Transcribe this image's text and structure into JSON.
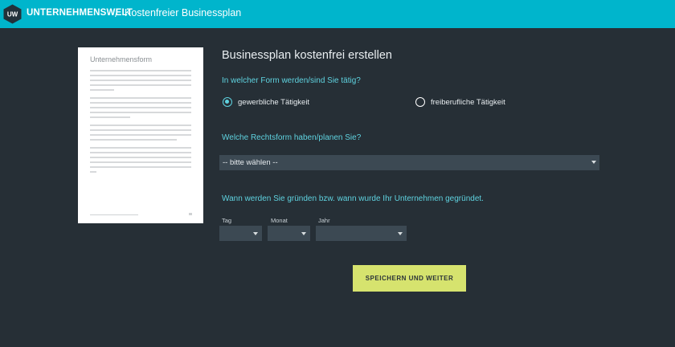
{
  "header": {
    "logo_text": "UW",
    "brand": "UNTERNEHMENSWELT",
    "separator": "/",
    "breadcrumb": "Kostenfreier Businessplan",
    "bg_color": "#00b5cc"
  },
  "preview": {
    "title": "Unternehmensform"
  },
  "form": {
    "title": "Businessplan kostenfrei erstellen",
    "question_form": "In welcher Form werden/sind Sie tätig?",
    "options": [
      {
        "label": "gewerbliche Tätigkeit",
        "selected": true
      },
      {
        "label": "freiberufliche Tätigkeit",
        "selected": false
      }
    ],
    "question_rechtsform": "Welche Rechtsform haben/planen Sie?",
    "rechtsform_value": "-- bitte wählen --",
    "question_date": "Wann werden Sie gründen bzw. wann wurde Ihr Unternehmen gegründet.",
    "date_labels": {
      "day": "Tag",
      "month": "Monat",
      "year": "Jahr"
    },
    "submit_label": "SPEICHERN UND WEITER",
    "accent_color": "#5fd3e0",
    "button_color": "#d6e36e"
  }
}
